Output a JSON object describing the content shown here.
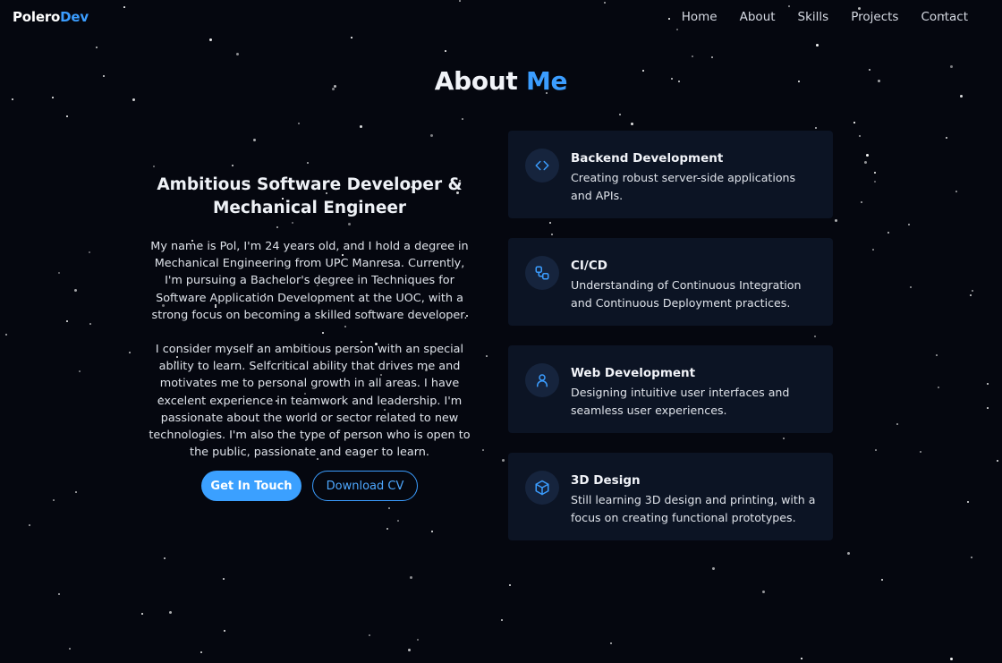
{
  "nav": {
    "logo_prefix": "Polero",
    "logo_accent": "Dev",
    "links": [
      "Home",
      "About",
      "Skills",
      "Projects",
      "Contact"
    ]
  },
  "about": {
    "title_prefix": "About",
    "title_accent": "Me",
    "subtitle": "Ambitious Software Developer & Mechanical Engineer",
    "paragraphs": [
      "My name is Pol, I'm 24 years old, and I hold a degree in Mechanical Engineering from UPC Manresa. Currently, I'm pursuing a Bachelor's degree in Techniques for Software Application Development at the UOC, with a strong focus on becoming a skilled software developer.",
      "I consider myself an ambitious person with an special ability to learn. Selfcritical ability that drives me and motivates me to personal growth in all areas. I have excelent experience in teamwork and leadership. I'm passionate about the world or sector related to new technologies. I'm also the type of person who is open to the public, passionate and eager to learn."
    ],
    "buttons": {
      "primary": "Get In Touch",
      "secondary": "Download CV"
    }
  },
  "skills_cards": [
    {
      "icon": "code-icon",
      "title": "Backend Development",
      "description": "Creating robust server-side applications and APIs."
    },
    {
      "icon": "workflow-icon",
      "title": "CI/CD",
      "description": "Understanding of Continuous Integration and Continuous Deployment practices."
    },
    {
      "icon": "user-icon",
      "title": "Web Development",
      "description": "Designing intuitive user interfaces and seamless user experiences."
    },
    {
      "icon": "cube-icon",
      "title": "3D Design",
      "description": "Still learning 3D design and printing, with a focus on creating functional prototypes."
    }
  ],
  "colors": {
    "background": "#05070f",
    "accent": "#3b9dff",
    "card_background": "#0c1424",
    "icon_circle": "#16243d"
  }
}
